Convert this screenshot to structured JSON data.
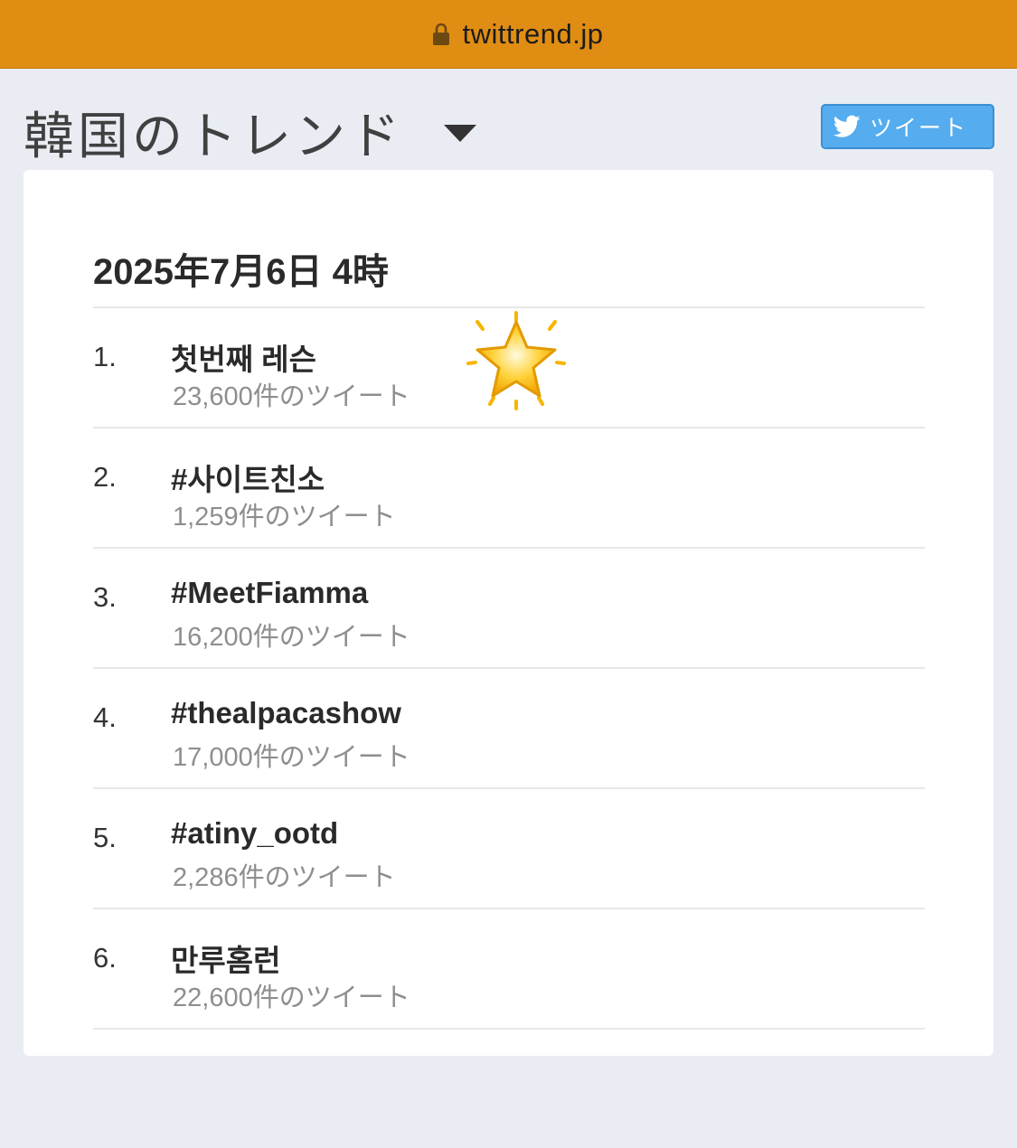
{
  "address_bar": {
    "url": "twittrend.jp"
  },
  "header": {
    "title": "韓国のトレンド",
    "tweet_button_label": "ツイート"
  },
  "trends": {
    "timestamp": "2025年7月6日 4時",
    "items": [
      {
        "rank": "1.",
        "name": "첫번째 레슨",
        "count": "23,600件のツイート"
      },
      {
        "rank": "2.",
        "name": "#사이트친소",
        "count": "1,259件のツイート"
      },
      {
        "rank": "3.",
        "name": "#MeetFiamma",
        "count": "16,200件のツイート"
      },
      {
        "rank": "4.",
        "name": "#thealpacashow",
        "count": "17,000件のツイート"
      },
      {
        "rank": "5.",
        "name": "#atiny_ootd",
        "count": "2,286件のツイート"
      },
      {
        "rank": "6.",
        "name": "만루홈런",
        "count": "22,600件のツイート"
      }
    ]
  },
  "icons": {
    "lock": "lock-icon",
    "dropdown": "caret-down-icon",
    "tweet": "twitter-bird-icon",
    "sticker": "glowing-star-icon"
  },
  "colors": {
    "address_bar": "#e08d13",
    "page_background": "#e9edf3",
    "tweet_button": "#55acee",
    "count_text": "#8e8e8e"
  }
}
